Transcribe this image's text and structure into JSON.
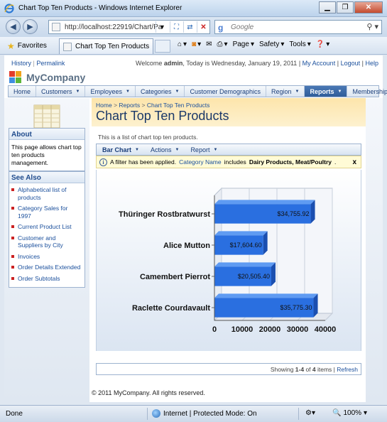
{
  "window": {
    "title": "Chart Top Ten Products - Windows Internet Explorer"
  },
  "address": {
    "url": "http://localhost:22919/Chart/Pa",
    "search_placeholder": "Google"
  },
  "favorites": {
    "label": "Favorites",
    "tab_title": "Chart Top Ten Products"
  },
  "commands": {
    "page": "Page",
    "safety": "Safety",
    "tools": "Tools"
  },
  "top": {
    "history": "History",
    "permalink": "Permalink",
    "sep": "|",
    "welcome_prefix": "Welcome ",
    "user": "admin",
    "welcome_suffix": ", Today is Wednesday, January 19, 2011",
    "my_account": "My Account",
    "logout": "Logout",
    "help": "Help"
  },
  "brand": {
    "name": "MyCompany"
  },
  "menu": {
    "items": [
      {
        "label": "Home",
        "dropdown": false
      },
      {
        "label": "Customers",
        "dropdown": true
      },
      {
        "label": "Employees",
        "dropdown": true
      },
      {
        "label": "Categories",
        "dropdown": true
      },
      {
        "label": "Customer Demographics",
        "dropdown": false
      },
      {
        "label": "Region",
        "dropdown": true
      },
      {
        "label": "Reports",
        "dropdown": true,
        "active": true
      },
      {
        "label": "Membership",
        "dropdown": false
      }
    ]
  },
  "sidebar": {
    "about_title": "About",
    "about_text": "This page allows chart top ten products management.",
    "see_also_title": "See Also",
    "links": [
      "Alphabetical list of products",
      "Category Sales for 1997",
      "Current Product List",
      "Customer and Suppliers by City",
      "Invoices",
      "Order Details Extended",
      "Order Subtotals"
    ]
  },
  "breadcrumb": {
    "home": "Home",
    "reports": "Reports",
    "current": "Chart Top Ten Products",
    "sep": ">"
  },
  "page_title": "Chart Top Ten Products",
  "description": "This is a list of chart top ten products.",
  "viewbar": {
    "bar_chart": "Bar Chart",
    "actions": "Actions",
    "report": "Report"
  },
  "filter": {
    "prefix": "A filter has been applied.",
    "field": "Category Name",
    "op": "includes",
    "values": "Dairy Products, Meat/Poultry",
    "suffix": ".",
    "close": "x"
  },
  "chart_data": {
    "type": "bar",
    "orientation": "horizontal",
    "categories": [
      "Thüringer Rostbratwurst",
      "Alice Mutton",
      "Camembert Pierrot",
      "Raclette Courdavault"
    ],
    "values": [
      34755.92,
      17604.6,
      20505.4,
      35775.3
    ],
    "labels": [
      "$34,755.92",
      "$17,604.60",
      "$20,505.40",
      "$35,775.30"
    ],
    "xlim": [
      0,
      40000
    ],
    "xticks": [
      "0",
      "10000",
      "20000",
      "30000",
      "40000"
    ],
    "bar_color": "#2a6fe0",
    "style": "3d",
    "grid": true
  },
  "pager": {
    "showing": "Showing ",
    "range": "1-4",
    "of": " of ",
    "total": "4",
    "items": " items | ",
    "refresh": "Refresh"
  },
  "footer": "© 2011 MyCompany. All rights reserved.",
  "status": {
    "done": "Done",
    "zone": "Internet | Protected Mode: On",
    "zoom": "100%"
  }
}
